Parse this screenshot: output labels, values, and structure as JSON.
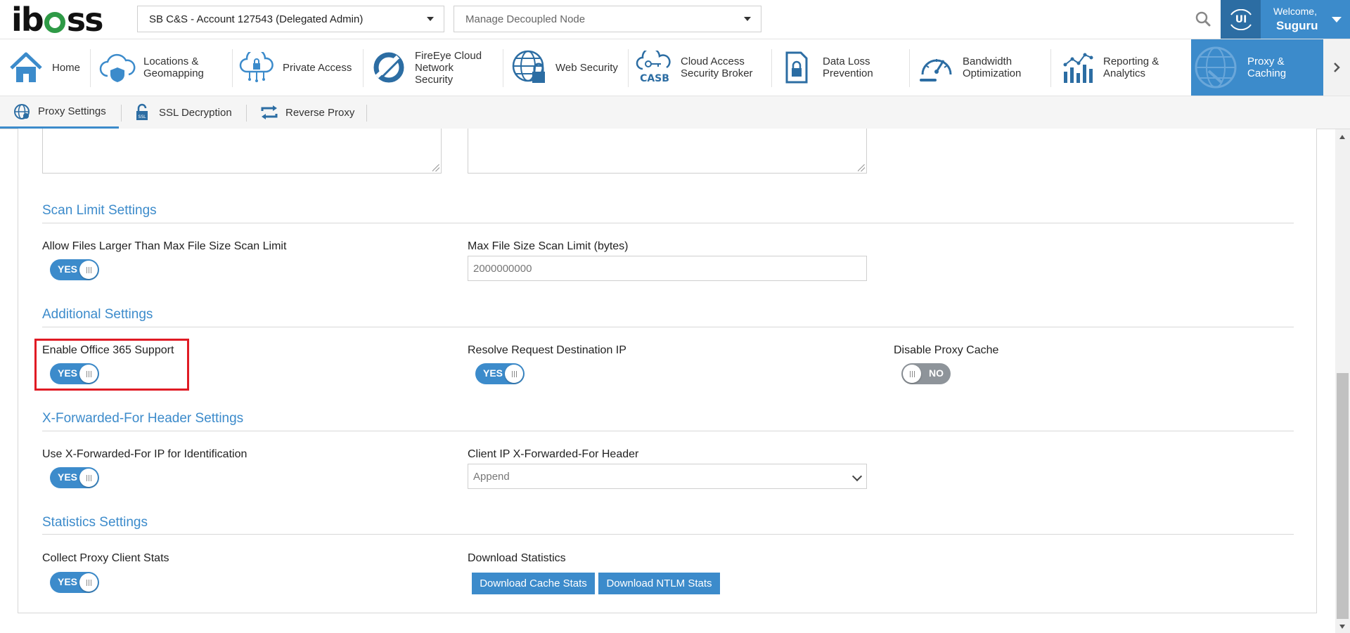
{
  "brand": {
    "logo_text_before": "ib",
    "logo_text_after": "ss"
  },
  "header": {
    "account_select": "SB C&S - Account 127543 (Delegated Admin)",
    "node_select": "Manage Decoupled Node",
    "welcome": "Welcome,",
    "user_name": "Suguru"
  },
  "mainnav": {
    "items": [
      {
        "label": "Home",
        "icon": "home-icon"
      },
      {
        "label": "Locations &\nGeomapping",
        "icon": "cloud-shield-icon"
      },
      {
        "label": "Private Access",
        "icon": "cloud-lock-icon"
      },
      {
        "label": "FireEye Cloud\nNetwork\nSecurity",
        "icon": "fireeye-icon"
      },
      {
        "label": "Web Security",
        "icon": "globe-lock-icon"
      },
      {
        "label": "Cloud Access\nSecurity Broker",
        "icon": "casb-icon",
        "icon_text": "CASB"
      },
      {
        "label": "Data Loss\nPrevention",
        "icon": "file-lock-icon"
      },
      {
        "label": "Bandwidth\nOptimization",
        "icon": "speedometer-icon"
      },
      {
        "label": "Reporting &\nAnalytics",
        "icon": "analytics-icon"
      },
      {
        "label": "Proxy &\nCaching",
        "icon": "proxy-globe-icon",
        "active": true
      }
    ]
  },
  "subtabs": {
    "items": [
      {
        "label": "Proxy Settings",
        "icon": "globe-gear-icon",
        "active": true
      },
      {
        "label": "SSL Decryption",
        "icon": "ssl-lock-icon"
      },
      {
        "label": "Reverse Proxy",
        "icon": "reverse-arrows-icon"
      }
    ]
  },
  "sections": {
    "scan_limit": {
      "title": "Scan Limit Settings",
      "allow_large_label": "Allow Files Larger Than Max File Size Scan Limit",
      "allow_large_toggle": "YES",
      "max_size_label": "Max File Size Scan Limit (bytes)",
      "max_size_value": "2000000000"
    },
    "additional": {
      "title": "Additional Settings",
      "office365_label": "Enable Office 365 Support",
      "office365_toggle": "YES",
      "resolve_label": "Resolve Request Destination IP",
      "resolve_toggle": "YES",
      "disable_cache_label": "Disable Proxy Cache",
      "disable_cache_toggle": "NO"
    },
    "xff": {
      "title": "X-Forwarded-For Header Settings",
      "use_xff_label": "Use X-Forwarded-For IP for Identification",
      "use_xff_toggle": "YES",
      "client_ip_label": "Client IP X-Forwarded-For Header",
      "client_ip_value": "Append"
    },
    "stats": {
      "title": "Statistics Settings",
      "collect_label": "Collect Proxy Client Stats",
      "collect_toggle": "YES",
      "download_label": "Download Statistics",
      "cache_button": "Download Cache Stats",
      "ntlm_button": "Download NTLM Stats"
    }
  },
  "colors": {
    "accent": "#3c8bcb",
    "accent_dark": "#2c6da3",
    "toggle_off": "#8e949a",
    "highlight": "#e01b24",
    "logo_green": "#2e9a46"
  }
}
